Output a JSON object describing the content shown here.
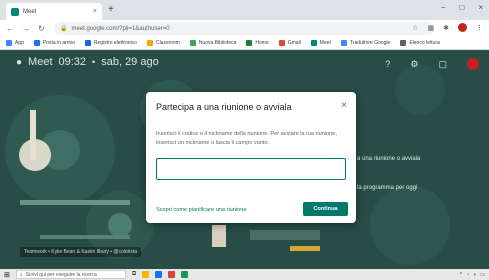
{
  "browser": {
    "tab_title": "Meet",
    "tab_close": "×",
    "new_tab": "+",
    "window_controls": [
      "−",
      "□",
      "×"
    ],
    "url": "meet.google.com/?pli=1&authuser=0",
    "nav_icons": [
      "back-icon",
      "forward-icon",
      "reload-icon"
    ],
    "bookmarks": [
      {
        "label": "App",
        "color": "#4285f4"
      },
      {
        "label": "Posta in arrivo",
        "color": "#1a73e8"
      },
      {
        "label": "Registro elettronico",
        "color": "#1967d2"
      },
      {
        "label": "Classroom",
        "color": "#f9ab00"
      },
      {
        "label": "Nuova Biblioteca",
        "color": "#34a853"
      },
      {
        "label": "Home",
        "color": "#188038"
      },
      {
        "label": "Gmail",
        "color": "#ea4335"
      },
      {
        "label": "Meet",
        "color": "#00897b"
      },
      {
        "label": "Traduttore Google",
        "color": "#4285f4"
      },
      {
        "label": "Elenco lettura",
        "color": "#5f6368"
      }
    ]
  },
  "meet": {
    "app_name": "Meet",
    "time": "09:32",
    "separator": "•",
    "date": "sab, 29 ago",
    "side_text_1": "a una riunione o avviala",
    "side_text_2": "la programma per oggi",
    "credit": "Teamwork • Kylie Bean & Kaelin Ilbury • @colorista"
  },
  "dialog": {
    "title": "Partecipa a una riunione o avviala",
    "close": "×",
    "body": "Inserisci il codice o il nickname della riunione. Per avviare la tua riunione, inserisci un nickname o lascia il campo vuoto.",
    "input_value": "",
    "input_placeholder": "",
    "link": "Scopri come pianificare una riunione",
    "button": "Continua"
  },
  "taskbar": {
    "search_placeholder": "Scrivi qui per eseguire la ricerca",
    "apps": [
      {
        "name": "explorer-icon",
        "color": "#f4b400"
      },
      {
        "name": "store-icon",
        "color": "#1a73e8"
      },
      {
        "name": "chrome-icon",
        "color": "#db4437"
      },
      {
        "name": "photos-icon",
        "color": "#0f9d58"
      }
    ]
  }
}
